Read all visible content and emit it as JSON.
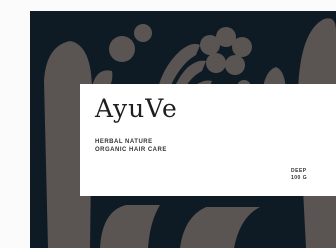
{
  "product": {
    "brand": "AyuVe",
    "tagline_line1": "HERBAL NATURE",
    "tagline_line2": "ORGANIC HAIR CARE",
    "variant": "DEEP",
    "size": "100 G"
  },
  "colors": {
    "box_background": "#0f1b24",
    "pattern_shapes": "#5a5552",
    "label_background": "#ffffff",
    "text": "#1e1e1e"
  }
}
